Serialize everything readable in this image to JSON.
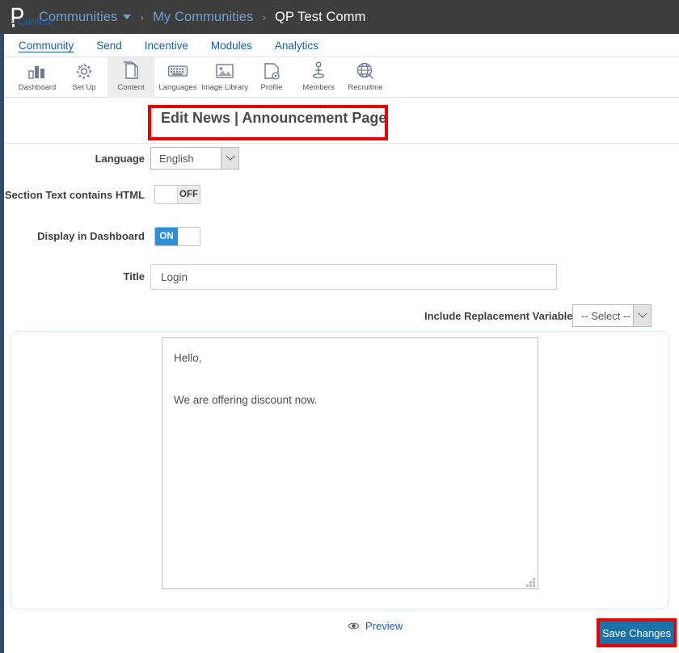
{
  "header": {
    "logo_icon": "p-logo-icon",
    "breadcrumb": [
      {
        "label": "Communities",
        "current": false,
        "has_caret": true
      },
      {
        "label": "My Communities",
        "current": false,
        "has_caret": false
      },
      {
        "label": "QP Test Comm",
        "current": true,
        "has_caret": false
      }
    ],
    "separator": "›"
  },
  "nav_tabs": [
    {
      "label": "Community",
      "active": true
    },
    {
      "label": "Send",
      "active": false
    },
    {
      "label": "Incentive",
      "active": false
    },
    {
      "label": "Modules",
      "active": false
    },
    {
      "label": "Analytics",
      "active": false
    }
  ],
  "icon_toolbar": [
    {
      "label": "Dashboard",
      "icon": "bar-chart-icon",
      "selected": false
    },
    {
      "label": "Set Up",
      "icon": "gear-icon",
      "selected": false
    },
    {
      "label": "Content",
      "icon": "pages-icon",
      "selected": true
    },
    {
      "label": "Languages",
      "icon": "keyboard-icon",
      "selected": false
    },
    {
      "label": "Image Library",
      "icon": "image-icon",
      "selected": false
    },
    {
      "label": "Profile",
      "icon": "profile-document-icon",
      "selected": false
    },
    {
      "label": "Members",
      "icon": "person-icon",
      "selected": false
    },
    {
      "label": "Recruitme",
      "icon": "globe-search-icon",
      "selected": false
    }
  ],
  "subheader": {
    "back_label": "Content",
    "back_chevron": "‹",
    "page_title": "Edit News | Announcement Page"
  },
  "form": {
    "language": {
      "label": "Language",
      "value": "English",
      "icon": "chevron-down-icon"
    },
    "section_html": {
      "label": "Section Text contains HTML",
      "state": "OFF",
      "on": false
    },
    "display_dashboard": {
      "label": "Display in Dashboard",
      "state": "ON",
      "on": true
    },
    "title": {
      "label": "Title",
      "value": "Login",
      "placeholder": "Title"
    },
    "replacement_variables": {
      "label": "Include Replacement Variables:",
      "value": "-- Select --",
      "icon": "chevron-down-icon"
    },
    "editor": {
      "value": "Hello,\n\nWe are offering discount now.",
      "resize_handle": "resize-grip-icon"
    }
  },
  "footer": {
    "preview_label": "Preview",
    "preview_icon": "eye-icon",
    "save_label": "Save Changes"
  },
  "annotations": [
    {
      "name": "title-highlight"
    },
    {
      "name": "save-highlight"
    }
  ],
  "colors": {
    "topbar_bg": "#3d3d3d",
    "breadcrumb_link": "#6ba3d6",
    "nav_link": "#1a5fa8",
    "toggle_on": "#2f8fd6",
    "save_button": "#1a73ab",
    "annotation_red": "#ee0000",
    "panel_border": "#d8ecf0",
    "left_rail": "#2f4a6d"
  }
}
